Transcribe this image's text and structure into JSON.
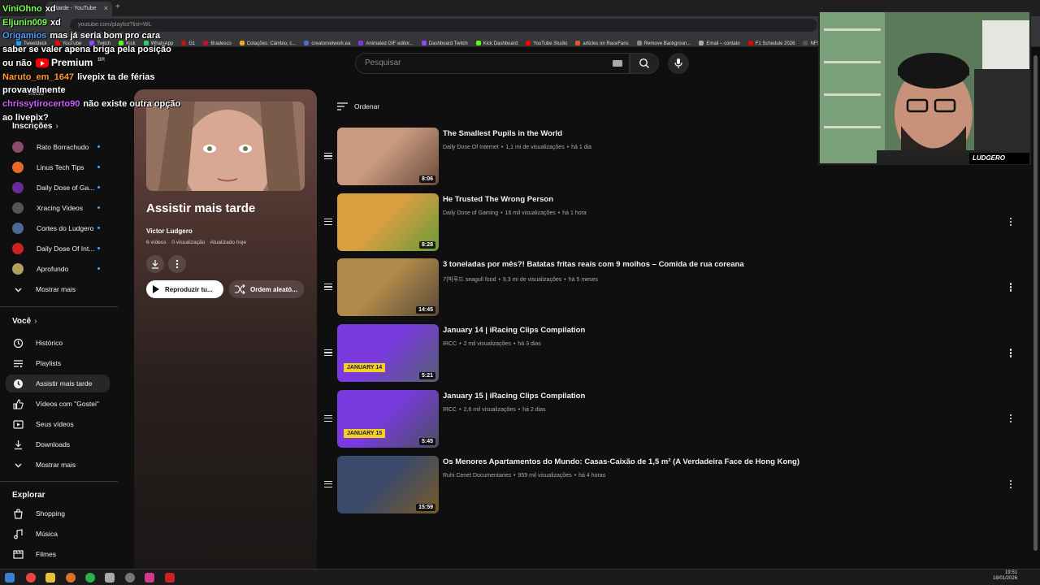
{
  "browser": {
    "tab_title": "…tarde - YouTube",
    "url": "youtube.com/playlist?list=WL",
    "bookmarks": [
      "Tweetdeck",
      "YouTube",
      "Twitch",
      "Kick",
      "WhatsApp",
      "G1",
      "Bradesco",
      "Cotações: Câmbio, c...",
      "creatornetwork.ea",
      "Animated GIF editor...",
      "Dashboard Twitch",
      "Kick Dashboard",
      "YouTube Studio",
      "articles on RaceFans",
      "Remove Backgroun...",
      "Email – contato",
      "F1 Schedule 2026",
      "NFS"
    ]
  },
  "header": {
    "logo_text": "Premium",
    "region": "BR",
    "search_placeholder": "Pesquisar"
  },
  "chat": [
    {
      "user": "ViniOhno",
      "color": "#7fff5a",
      "msg": "xd"
    },
    {
      "user": "Eljunin009",
      "color": "#7fff5a",
      "msg": "xd"
    },
    {
      "user": "Origamios",
      "color": "#4a9cff",
      "msg": "mas já seria bom pro cara saber se valer apena briga pela posição ou não"
    },
    {
      "user": "Naruto_em_1647",
      "color": "#ff9a2e",
      "msg": "livepix ta de férias provavelmente"
    },
    {
      "user": "chrissytirocerto90",
      "color": "#d15cff",
      "msg": "não existe outra opção ao livepix?"
    }
  ],
  "sidebar": {
    "home_label": "Início",
    "subs_title": "Inscrições",
    "subscriptions": [
      {
        "name": "Rato Borrachudo",
        "color": "#8a4a6a"
      },
      {
        "name": "Linus Tech Tips",
        "color": "#e86a2a"
      },
      {
        "name": "Daily Dose of Ga...",
        "color": "#6a2a9a"
      },
      {
        "name": "Xracing Videos",
        "color": "#555"
      },
      {
        "name": "Cortes do Ludgero",
        "color": "#4a6a9a"
      },
      {
        "name": "Daily Dose Of Int...",
        "color": "#c22"
      },
      {
        "name": "Aprofundo",
        "color": "#b0a060"
      }
    ],
    "subs_more": "Mostrar mais",
    "you_title": "Você",
    "you_items": [
      "Histórico",
      "Playlists",
      "Assistir mais tarde",
      "Vídeos com \"Gostei\"",
      "Seus vídeos",
      "Downloads",
      "Mostrar mais"
    ],
    "explore_title": "Explorar",
    "explore_items": [
      "Shopping",
      "Música",
      "Filmes"
    ]
  },
  "playlist": {
    "title": "Assistir mais tarde",
    "owner": "Victor Ludgero",
    "count": "6 vídeos",
    "views": "0 visualização",
    "updated": "Atualizado hoje",
    "play_label": "Reproduzir tu...",
    "shuffle_label": "Ordem aleató..."
  },
  "sort_label": "Ordenar",
  "videos": [
    {
      "title": "The Smallest Pupils in the World",
      "channel": "Daily Dose Of Internet",
      "views": "1,1 mi de visualizações",
      "age": "há 1 dia",
      "duration": "8:06",
      "c1": "#c99a80",
      "c2": "#6a4a3a"
    },
    {
      "title": "He Trusted The Wrong Person",
      "channel": "Daily Dose of Gaming",
      "views": "16 mil visualizações",
      "age": "há 1 hora",
      "duration": "8:28",
      "c1": "#d8a040",
      "c2": "#6a9a3a"
    },
    {
      "title": "3 toneladas por mês?! Batatas fritas reais com 9 molhos – Comida de rua coreana",
      "channel": "기박푸드 seagull food",
      "views": "9,3 mi de visualizações",
      "age": "há 5 meses",
      "duration": "14:45",
      "c1": "#b08a4a",
      "c2": "#5a4a3a"
    },
    {
      "title": "January 14 | iRacing Clips Compilation",
      "channel": "IRCC",
      "views": "2 mil visualizações",
      "age": "há 3 dias",
      "duration": "5:21",
      "c1": "#7a3adf",
      "c2": "#556070",
      "badge": "JANUARY 14"
    },
    {
      "title": "January 15 | iRacing Clips Compilation",
      "channel": "IRCC",
      "views": "2,6 mil visualizações",
      "age": "há 2 dias",
      "duration": "5:45",
      "c1": "#7a3adf",
      "c2": "#4a5060",
      "badge": "JANUARY 15"
    },
    {
      "title": "Os Menores Apartamentos do Mundo: Casas-Caixão de 1,5 m² (A Verdadeira Face de Hong Kong)",
      "channel": "Ruhi Cenet Documentaries",
      "views": "959 mil visualizações",
      "age": "há 4 horas",
      "duration": "15:59",
      "c1": "#3a4a6a",
      "c2": "#7a5a2a"
    }
  ],
  "webcam": {
    "logo": "LUDGERO"
  },
  "taskbar": {
    "time": "19:51",
    "date": "18/01/2026"
  }
}
